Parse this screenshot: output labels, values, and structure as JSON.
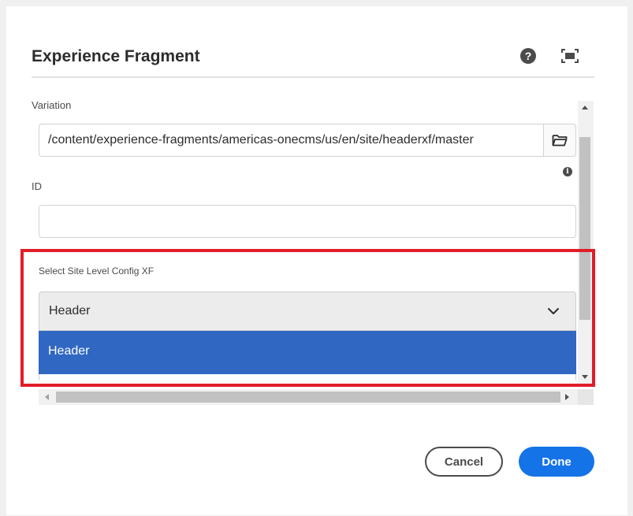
{
  "dialog": {
    "title": "Experience Fragment",
    "help_icon": "help-icon",
    "fullscreen_icon": "fullscreen-icon"
  },
  "fields": {
    "variation": {
      "label": "Variation",
      "value": "/content/experience-fragments/americas-onecms/us/en/site/headerxf/master",
      "browse_icon": "folder-icon"
    },
    "id": {
      "label": "ID",
      "value": "",
      "info_icon": "info-icon"
    },
    "site_config": {
      "label": "Select Site Level Config XF",
      "selected": "Header",
      "options": [
        "Header"
      ],
      "chevron_icon": "chevron-down-icon"
    }
  },
  "footer": {
    "cancel_label": "Cancel",
    "done_label": "Done"
  },
  "colors": {
    "accent": "#1473e6",
    "selected_option": "#3067c3",
    "highlight": "#e11d28"
  }
}
